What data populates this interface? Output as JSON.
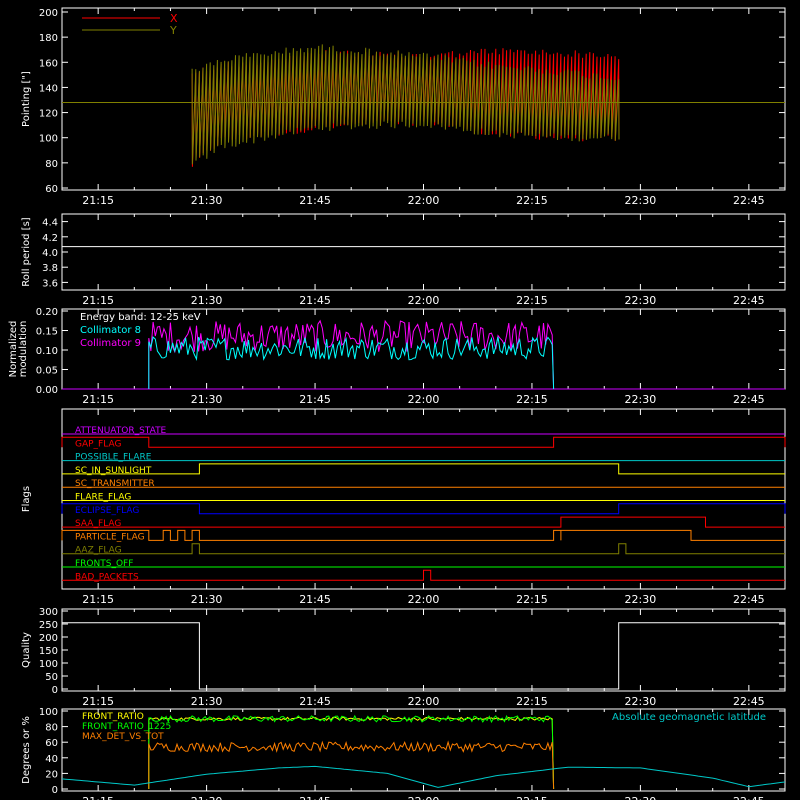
{
  "x_ticks": [
    "21:15",
    "21:30",
    "21:45",
    "22:00",
    "22:15",
    "22:30",
    "22:45"
  ],
  "chart_data": [
    {
      "type": "line",
      "panel": "pointing",
      "ylabel": "Pointing [\"]",
      "ylim": [
        60,
        200
      ],
      "yticks": [
        60,
        80,
        100,
        120,
        140,
        160,
        180,
        200
      ],
      "xlim": [
        "21:10",
        "22:50"
      ],
      "legend": "top-left",
      "series": [
        {
          "name": "X",
          "color": "#ff0000",
          "kind": "oscillating",
          "t": [
            "21:28",
            "21:32",
            "21:45",
            "22:00",
            "22:10",
            "22:20",
            "22:27"
          ],
          "upper": [
            155,
            160,
            170,
            168,
            172,
            170,
            168
          ],
          "lower": [
            75,
            95,
            105,
            110,
            100,
            97,
            97
          ]
        },
        {
          "name": "Y",
          "color": "#808000",
          "kind": "oscillating",
          "t": [
            "21:28",
            "21:32",
            "21:45",
            "22:00",
            "22:10",
            "22:20",
            "22:27"
          ],
          "upper": [
            155,
            165,
            175,
            168,
            160,
            155,
            150
          ],
          "lower": [
            75,
            90,
            105,
            108,
            100,
            97,
            97
          ]
        },
        {
          "name": "",
          "color": "#808000",
          "kind": "hline",
          "value": 128
        }
      ]
    },
    {
      "type": "line",
      "panel": "roll",
      "ylabel": "Roll period [s]",
      "ylim": [
        3.5,
        4.5
      ],
      "yticks": [
        3.6,
        3.8,
        4.0,
        4.2,
        4.4
      ],
      "yticklabels": [
        "3.6",
        "3.8",
        "4.0",
        "4.2",
        "4.4"
      ],
      "series": [
        {
          "name": "",
          "color": "#ffffff",
          "kind": "hline",
          "value": 4.07
        }
      ]
    },
    {
      "type": "line",
      "panel": "modulation",
      "ylabel": "Normalized modulation",
      "ylim": [
        0,
        0.2
      ],
      "yticks": [
        0,
        0.05,
        0.1,
        0.15,
        0.2
      ],
      "yticklabels": [
        "0.00",
        "0.05",
        "0.10",
        "0.15",
        "0.20"
      ],
      "annotation": "Energy band: 12-25 keV",
      "series": [
        {
          "name": "Collimator 8",
          "color": "#00ffff",
          "start": "21:22",
          "end": "22:18",
          "mean": 0.105,
          "spread": 0.03
        },
        {
          "name": "Collimator 9",
          "color": "#ff00ff",
          "start": "21:22",
          "end": "22:18",
          "mean": 0.135,
          "spread": 0.04
        }
      ]
    },
    {
      "type": "line",
      "panel": "flags",
      "ylabel": "Flags",
      "flags": [
        {
          "name": "ATTENUATOR_STATE",
          "color": "#cc00ff",
          "highs": []
        },
        {
          "name": "GAP_FLAG",
          "color": "#ff0000",
          "highs": [
            [
              "21:10",
              "21:22"
            ],
            [
              "22:18",
              "22:50"
            ]
          ]
        },
        {
          "name": "POSSIBLE_FLARE",
          "color": "#00c8c8",
          "highs": []
        },
        {
          "name": "SC_IN_SUNLIGHT",
          "color": "#ffff00",
          "highs": [
            [
              "21:29",
              "22:27"
            ]
          ]
        },
        {
          "name": "SC_TRANSMITTER",
          "color": "#ff8000",
          "highs": []
        },
        {
          "name": "FLARE_FLAG",
          "color": "#ffff00",
          "highs": []
        },
        {
          "name": "ECLIPSE_FLAG",
          "color": "#0000ff",
          "highs": [
            [
              "21:10",
              "21:29"
            ],
            [
              "22:27",
              "22:50"
            ]
          ]
        },
        {
          "name": "SAA_FLAG",
          "color": "#ff0000",
          "highs": [
            [
              "22:19",
              "22:39"
            ]
          ]
        },
        {
          "name": "PARTICLE_FLAG",
          "color": "#ff8000",
          "highs": [
            [
              "21:10",
              "21:22"
            ],
            [
              "21:24",
              "21:25"
            ],
            [
              "21:26",
              "21:27"
            ],
            [
              "21:28",
              "21:29"
            ],
            [
              "22:18",
              "22:19"
            ],
            [
              "22:19",
              "22:37"
            ]
          ]
        },
        {
          "name": "AAZ_FLAG",
          "color": "#808000",
          "highs": [
            [
              "21:28",
              "21:29"
            ],
            [
              "22:27",
              "22:28"
            ]
          ]
        },
        {
          "name": "FRONTS_OFF",
          "color": "#00ff00",
          "highs": []
        },
        {
          "name": "BAD_PACKETS",
          "color": "#ff0000",
          "highs": [
            [
              "22:00",
              "22:01"
            ]
          ]
        }
      ]
    },
    {
      "type": "line",
      "panel": "quality",
      "ylabel": "Quality",
      "ylim": [
        0,
        300
      ],
      "yticks": [
        0,
        50,
        100,
        150,
        200,
        250,
        300
      ],
      "series": [
        {
          "name": "",
          "color": "#ffffff",
          "kind": "step",
          "t": [
            "21:10",
            "21:29",
            "21:29",
            "22:27",
            "22:27",
            "22:50"
          ],
          "values": [
            255,
            255,
            0,
            0,
            255,
            255
          ]
        }
      ]
    },
    {
      "type": "line",
      "panel": "degrees",
      "ylabel": "Degrees or %",
      "ylim": [
        0,
        100
      ],
      "yticks": [
        0,
        20,
        40,
        60,
        80,
        100
      ],
      "annotation": "Absolute geomagnetic latitude",
      "series": [
        {
          "name": "FRONT_RATIO",
          "color": "#ffff00",
          "start": "21:22",
          "end": "22:18",
          "mean": 90,
          "spread": 2
        },
        {
          "name": "FRONT_RATIO_1225",
          "color": "#00ff00",
          "start": "21:22",
          "end": "22:18",
          "mean": 90,
          "spread": 4
        },
        {
          "name": "MAX_DET_VS_TOT",
          "color": "#ff8000",
          "start": "21:22",
          "end": "22:18",
          "mean": 54,
          "spread": 6
        },
        {
          "name": "",
          "color": "#00c8c8",
          "kind": "curve",
          "t": [
            "21:10",
            "21:20",
            "21:30",
            "21:40",
            "21:45",
            "21:55",
            "22:02",
            "22:10",
            "22:20",
            "22:30",
            "22:40",
            "22:45",
            "22:50"
          ],
          "values": [
            13,
            5,
            19,
            27,
            29,
            20,
            2,
            17,
            28,
            27,
            14,
            3,
            9
          ]
        }
      ]
    }
  ]
}
